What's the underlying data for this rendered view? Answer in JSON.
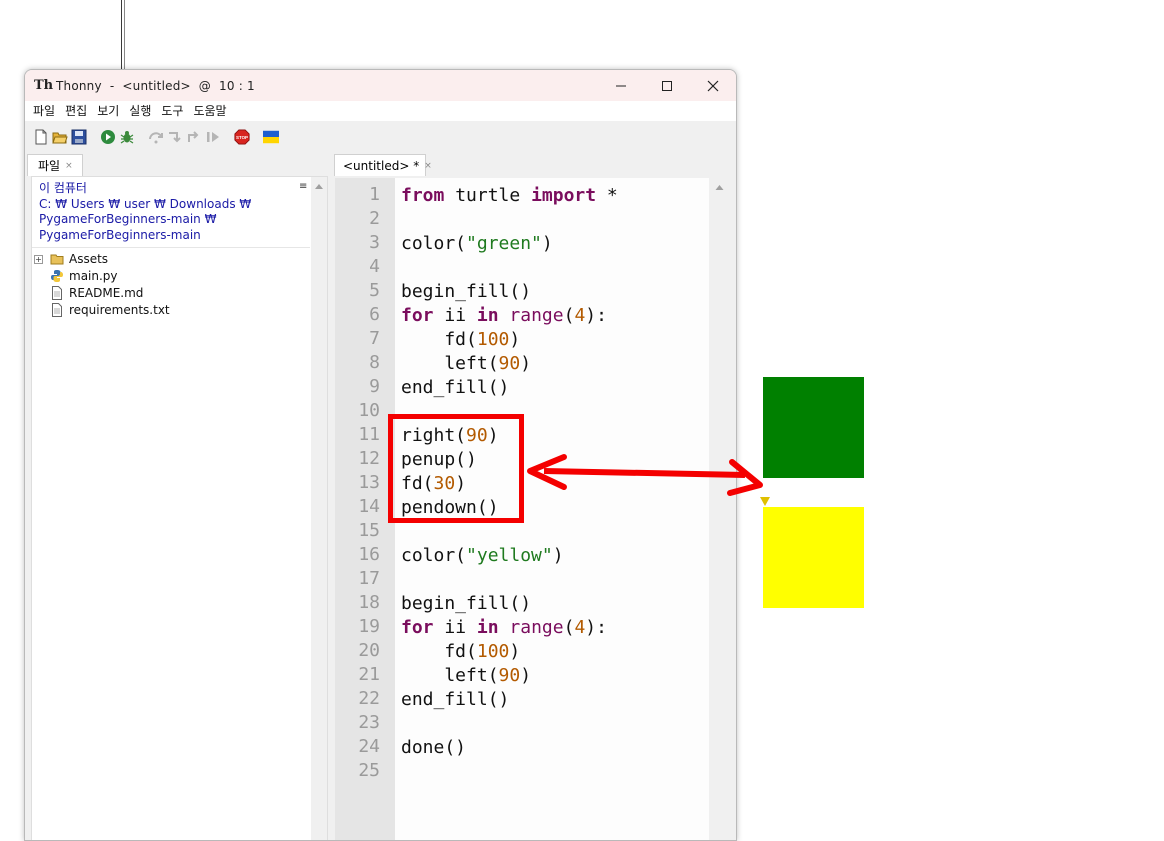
{
  "window": {
    "title": "Thonny  -  <untitled>  @  10 : 1",
    "controls": [
      "minimize-icon",
      "maximize-icon",
      "close-icon"
    ]
  },
  "menu": [
    "파일",
    "편집",
    "보기",
    "실행",
    "도구",
    "도움말"
  ],
  "toolbar": {
    "icons": [
      "new-file-icon",
      "open-file-icon",
      "save-icon",
      "run-icon",
      "debug-icon",
      "step-over-icon",
      "step-into-icon",
      "step-out-icon",
      "resume-icon",
      "stop-icon",
      "ukraine-flag-icon"
    ]
  },
  "files_panel": {
    "tab_label": "파일",
    "path_lines": [
      "이 컴퓨터",
      "C: ₩ Users ₩ user ₩ Downloads ₩",
      "PygameForBeginners-main ₩",
      "PygameForBeginners-main"
    ],
    "menu_glyph": "≡",
    "items": [
      {
        "label": "Assets",
        "icon": "folder-icon",
        "expandable": true
      },
      {
        "label": "main.py",
        "icon": "python-file-icon"
      },
      {
        "label": "README.md",
        "icon": "text-file-icon"
      },
      {
        "label": "requirements.txt",
        "icon": "text-file-icon"
      }
    ]
  },
  "editor": {
    "tab_label": "<untitled> *",
    "line_numbers": [
      "1",
      "2",
      "3",
      "4",
      "5",
      "6",
      "7",
      "8",
      "9",
      "10",
      "11",
      "12",
      "13",
      "14",
      "15",
      "16",
      "17",
      "18",
      "19",
      "20",
      "21",
      "22",
      "23",
      "24",
      "25"
    ],
    "lines": [
      [
        [
          "kw",
          "from"
        ],
        [
          "t",
          " turtle "
        ],
        [
          "kw",
          "import"
        ],
        [
          "t",
          " *"
        ]
      ],
      [],
      [
        [
          "t",
          "color("
        ],
        [
          "str",
          "\"green\""
        ],
        [
          "t",
          ")"
        ]
      ],
      [],
      [
        [
          "t",
          "begin_fill()"
        ]
      ],
      [
        [
          "kw",
          "for"
        ],
        [
          "t",
          " ii "
        ],
        [
          "kw",
          "in"
        ],
        [
          "t",
          " "
        ],
        [
          "bi",
          "range"
        ],
        [
          "t",
          "("
        ],
        [
          "num",
          "4"
        ],
        [
          "t",
          "):"
        ]
      ],
      [
        [
          "t",
          "    fd("
        ],
        [
          "num",
          "100"
        ],
        [
          "t",
          ")"
        ]
      ],
      [
        [
          "t",
          "    left("
        ],
        [
          "num",
          "90"
        ],
        [
          "t",
          ")"
        ]
      ],
      [
        [
          "t",
          "end_fill()"
        ]
      ],
      [],
      [
        [
          "t",
          "right("
        ],
        [
          "num",
          "90"
        ],
        [
          "t",
          ")"
        ]
      ],
      [
        [
          "t",
          "penup()"
        ]
      ],
      [
        [
          "t",
          "fd("
        ],
        [
          "num",
          "30"
        ],
        [
          "t",
          ")"
        ]
      ],
      [
        [
          "t",
          "pendown()"
        ]
      ],
      [],
      [
        [
          "t",
          "color("
        ],
        [
          "str",
          "\"yellow\""
        ],
        [
          "t",
          ")"
        ]
      ],
      [],
      [
        [
          "t",
          "begin_fill()"
        ]
      ],
      [
        [
          "kw",
          "for"
        ],
        [
          "t",
          " ii "
        ],
        [
          "kw",
          "in"
        ],
        [
          "t",
          " "
        ],
        [
          "bi",
          "range"
        ],
        [
          "t",
          "("
        ],
        [
          "num",
          "4"
        ],
        [
          "t",
          "):"
        ]
      ],
      [
        [
          "t",
          "    fd("
        ],
        [
          "num",
          "100"
        ],
        [
          "t",
          ")"
        ]
      ],
      [
        [
          "t",
          "    left("
        ],
        [
          "num",
          "90"
        ],
        [
          "t",
          ")"
        ]
      ],
      [
        [
          "t",
          "end_fill()"
        ]
      ],
      [],
      [
        [
          "t",
          "done()"
        ]
      ],
      []
    ]
  },
  "colors": {
    "annotation_red": "#f40000",
    "turtle_green": "#008000",
    "turtle_yellow": "#ffff00"
  }
}
